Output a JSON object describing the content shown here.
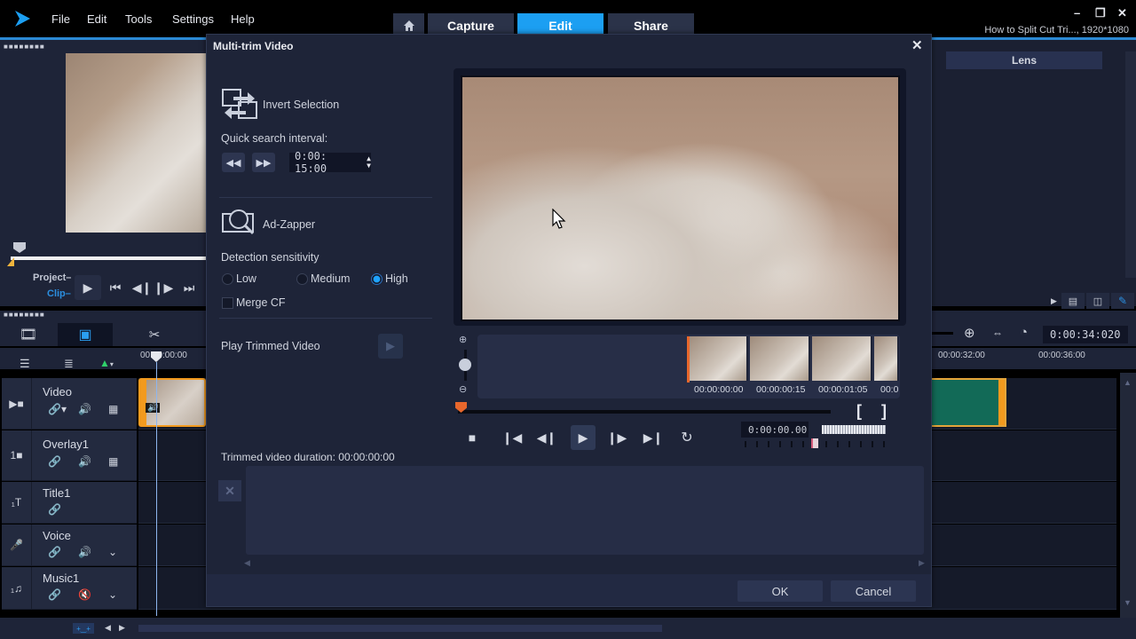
{
  "app": {
    "menu": [
      "File",
      "Edit",
      "Tools",
      "Settings",
      "Help"
    ],
    "tabs": [
      {
        "label": "Capture",
        "active": false
      },
      {
        "label": "Edit",
        "active": true
      },
      {
        "label": "Share",
        "active": false
      }
    ],
    "project_title": "How to Split Cut Tri..., 1920*1080",
    "window_controls": {
      "minimize": "–",
      "restore": "❐",
      "close": "✕"
    },
    "accent_color": "#1c9ff2"
  },
  "preview": {
    "project_label": "Project",
    "clip_label": "Clip",
    "icons": [
      "play-icon",
      "go-to-start-icon",
      "previous-frame-icon",
      "next-frame-icon",
      "go-to-end-icon"
    ]
  },
  "right_panel": {
    "tab_label": "Lens"
  },
  "timeline": {
    "timecode": "0:00:34:020",
    "ruler": [
      "00:00:00:00",
      "00:00:32:00",
      "00:00:36:00"
    ],
    "tracks": [
      {
        "name": "Video",
        "icon": "video-track-icon"
      },
      {
        "name": "Overlay1",
        "icon": "overlay-track-icon"
      },
      {
        "name": "Title1",
        "icon": "title-track-icon"
      },
      {
        "name": "Voice",
        "icon": "voice-track-icon"
      },
      {
        "name": "Music1",
        "icon": "music-track-icon"
      }
    ]
  },
  "dialog": {
    "title": "Multi-trim Video",
    "invert_selection": "Invert Selection",
    "quick_search_label": "Quick search interval:",
    "quick_search_value": "0:00: 15:00",
    "ad_zapper": "Ad-Zapper",
    "detection_label": "Detection sensitivity",
    "sensitivity_options": [
      {
        "label": "Low",
        "selected": false
      },
      {
        "label": "Medium",
        "selected": false
      },
      {
        "label": "High",
        "selected": true
      }
    ],
    "merge_cf_label": "Merge CF",
    "merge_cf_checked": false,
    "play_trimmed_label": "Play Trimmed Video",
    "thumb_times": [
      "00:00:00:00",
      "00:00:00:15",
      "00:00:01:05",
      "00:0"
    ],
    "timecode": "0:00:00.00",
    "bracket_in": "[",
    "bracket_out": "]",
    "trimmed_duration": "Trimmed video duration: 00:00:00:00",
    "ok_label": "OK",
    "cancel_label": "Cancel"
  }
}
